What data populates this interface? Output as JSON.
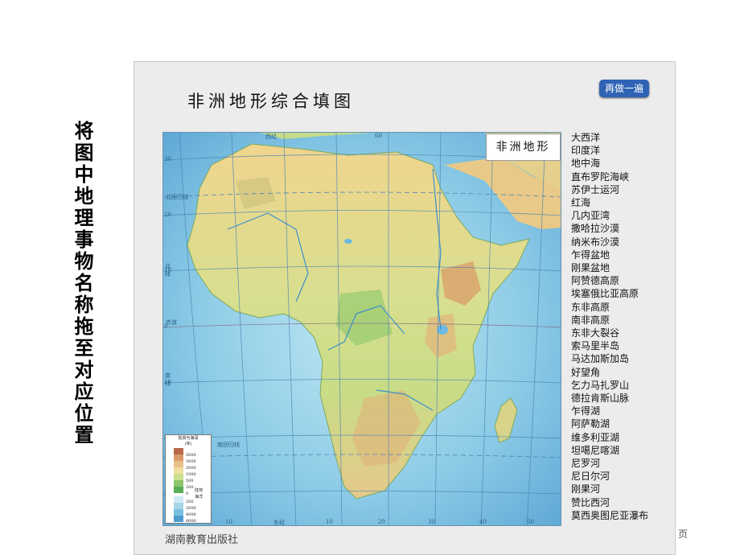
{
  "instruction": "将图中地理事物名称拖至对应位置",
  "panel": {
    "title": "非洲地形综合填图",
    "redo_button": "再做一遍",
    "map_caption": "非洲地形",
    "publisher": "湖南教育出版社"
  },
  "labels": [
    "大西洋",
    "印度洋",
    "地中海",
    "直布罗陀海峡",
    "苏伊士运河",
    "红海",
    "几内亚湾",
    "撒哈拉沙漠",
    "纳米布沙漠",
    "乍得盆地",
    "刚果盆地",
    "阿赞德高原",
    "埃塞俄比亚高原",
    "东非高原",
    "南非高原",
    "东非大裂谷",
    "索马里半岛",
    "马达加斯加岛",
    "好望角",
    "乞力马扎罗山",
    "德拉肯斯山脉",
    "乍得湖",
    "阿萨勒湖",
    "维多利亚湖",
    "坦噶尼喀湖",
    "尼罗河",
    "尼日尔河",
    "刚果河",
    "赞比西河",
    "莫西奥图尼亚瀑布"
  ],
  "map": {
    "lat_labels": [
      "30",
      "20",
      "10",
      "0",
      "10",
      "20",
      "30"
    ],
    "lon_labels": [
      "10",
      "0",
      "10",
      "20",
      "30",
      "40",
      "50",
      "60"
    ],
    "line_labels": {
      "cancer": "北回归线",
      "north_lat": "北纬",
      "equator": "赤道",
      "south_lat": "南纬",
      "capricorn": "南回归线",
      "west_lon": "西经",
      "east_lon": "东经"
    },
    "legend": {
      "title": "陆高与海深",
      "unit": "(米)",
      "land_values": [
        "5000",
        "3000",
        "2000",
        "1000",
        "500",
        "200",
        "0"
      ],
      "land_label": "陆地",
      "sea_label": "海洋",
      "sea_values": [
        "200",
        "2000",
        "4000",
        "6000"
      ],
      "land_colors": [
        "#b86a4a",
        "#d99a6a",
        "#e8c08a",
        "#f2dfa0",
        "#c9de8e",
        "#8cc66a",
        "#5aae58"
      ],
      "sea_colors": [
        "#cfeaf4",
        "#a7d6ea",
        "#79bfe0",
        "#4d9dcd"
      ]
    }
  },
  "footer": {
    "page_text": "页"
  }
}
